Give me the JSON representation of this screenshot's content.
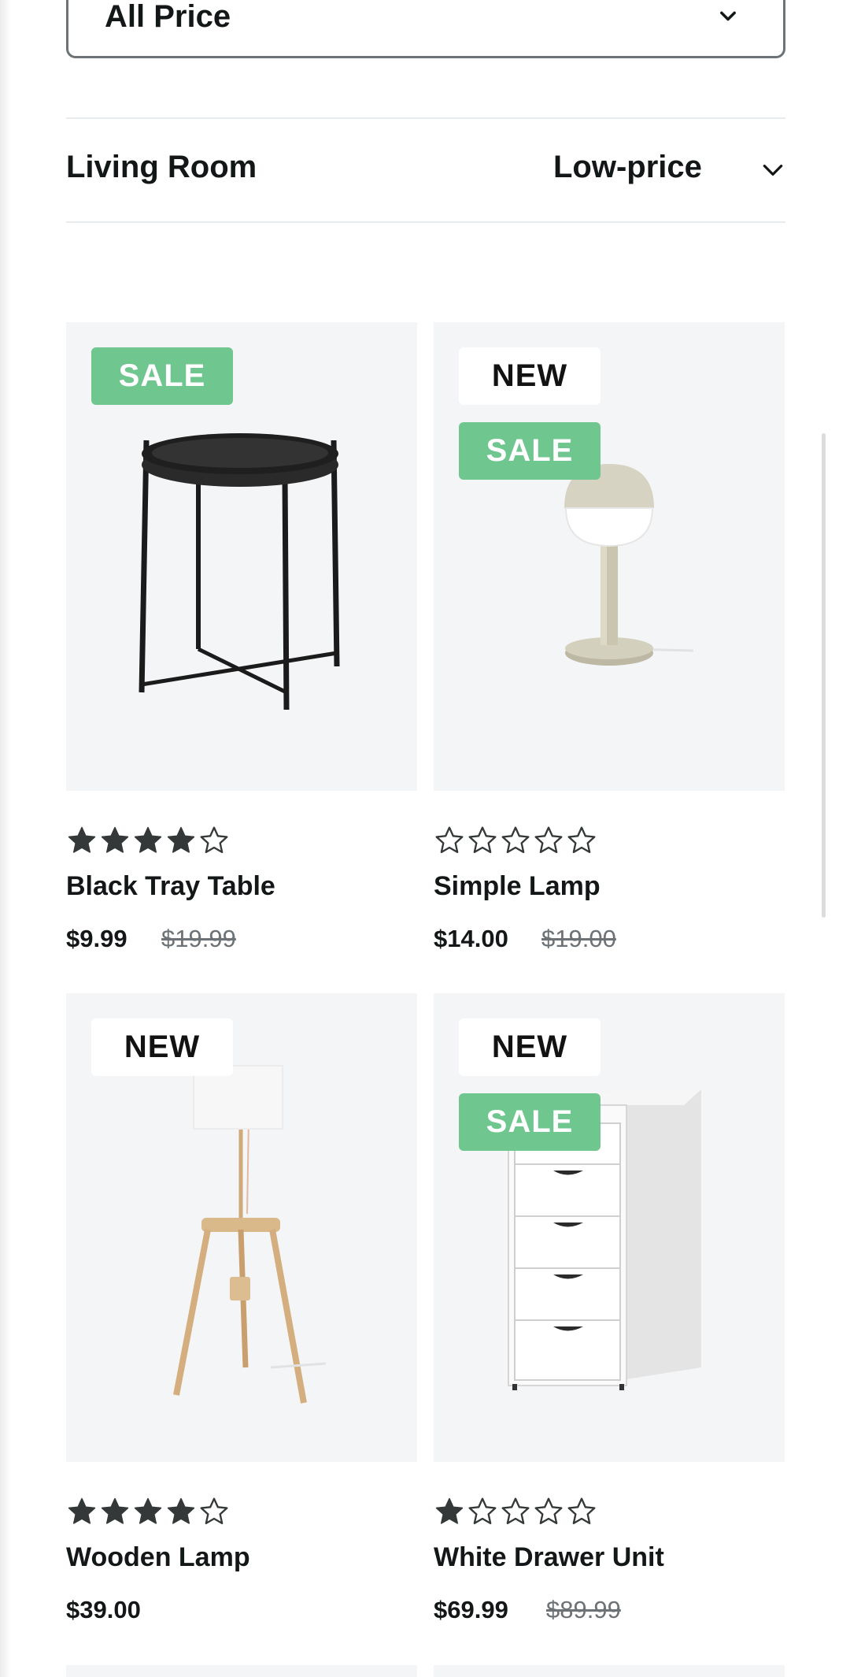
{
  "filters": {
    "price_select": {
      "value": "All Price"
    },
    "category": "Living Room",
    "sort": {
      "label": "Low-price"
    }
  },
  "products": [
    {
      "name": "Black Tray Table",
      "price": "$9.99",
      "old_price": "$19.99",
      "rating": 4,
      "badges": [
        "SALE"
      ]
    },
    {
      "name": "Simple Lamp",
      "price": "$14.00",
      "old_price": "$19.00",
      "rating": 0,
      "badges": [
        "NEW",
        "SALE"
      ]
    },
    {
      "name": "Wooden Lamp",
      "price": "$39.00",
      "old_price": "",
      "rating": 4,
      "badges": [
        "NEW"
      ]
    },
    {
      "name": "White Drawer Unit",
      "price": "$69.99",
      "old_price": "$89.99",
      "rating": 1,
      "badges": [
        "NEW",
        "SALE"
      ]
    }
  ],
  "colors": {
    "sale_badge": "#6fc68f",
    "card_bg": "#f3f5f7",
    "text": "#141718",
    "muted": "#6c7275"
  },
  "icons": {
    "dropdown": "chevron-down-icon",
    "rating": "star-icon"
  }
}
